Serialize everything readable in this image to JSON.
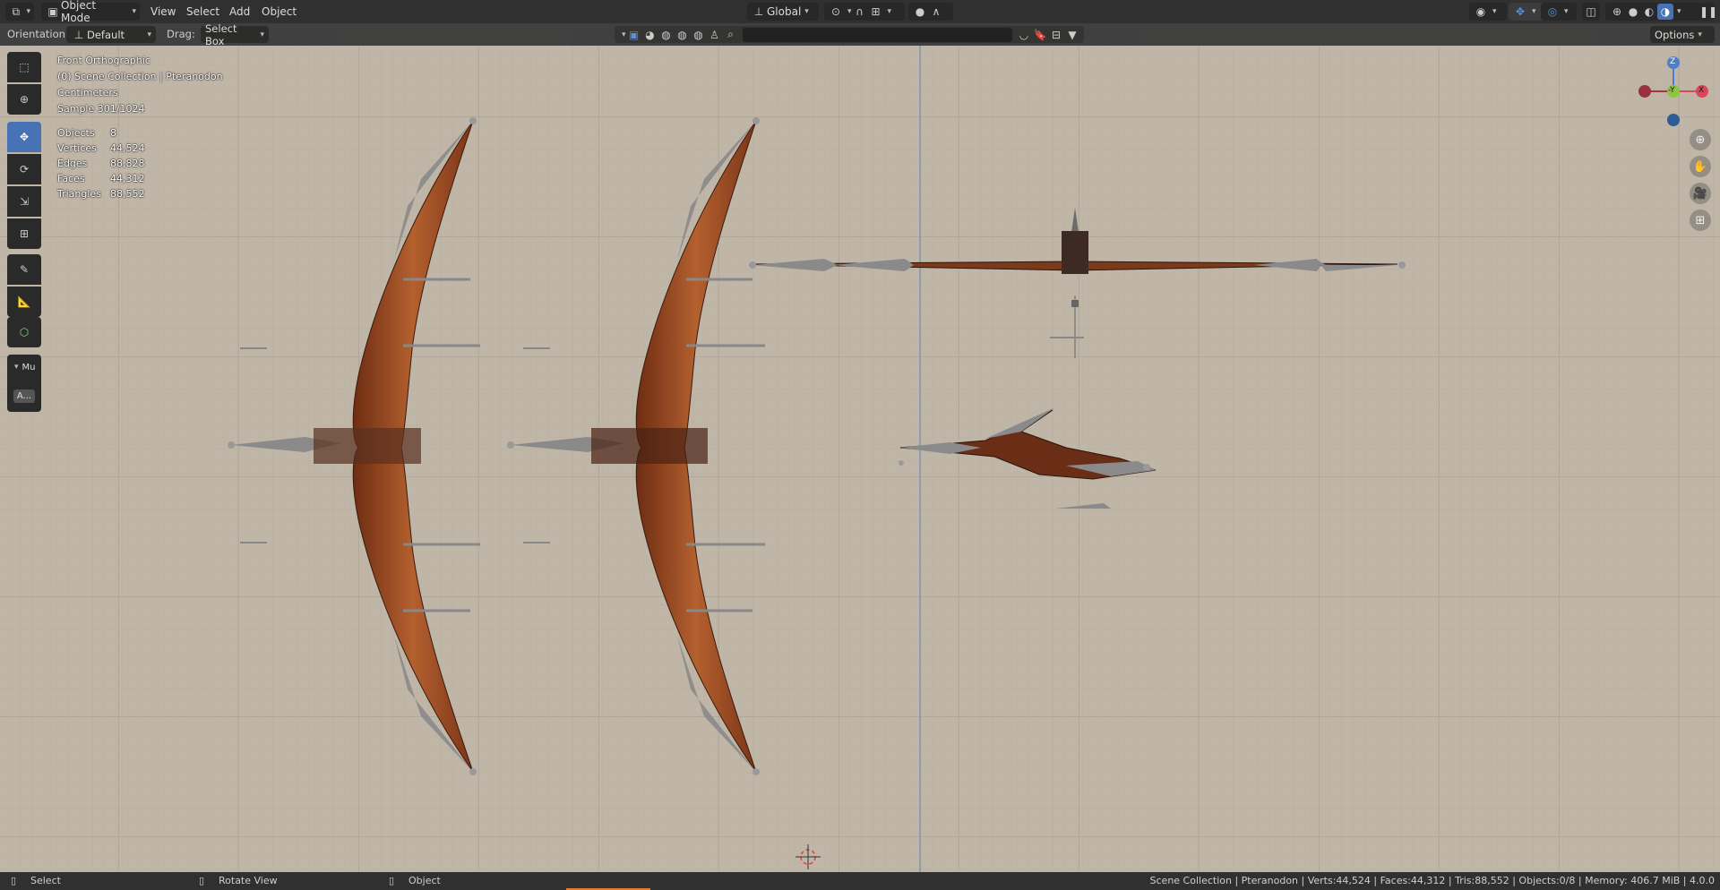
{
  "header": {
    "mode": "Object Mode",
    "menus": [
      "View",
      "Select",
      "Add",
      "Object"
    ],
    "orientation": "Global",
    "options_label": "Options"
  },
  "tool_settings": {
    "orientation_label": "Orientation:",
    "orientation_value": "Default",
    "drag_label": "Drag:",
    "drag_value": "Select Box"
  },
  "toolbar": {
    "collapsed_label": "Mu",
    "extra_label": "A..."
  },
  "viewport": {
    "view_name": "Front Orthographic",
    "collection": "(0) Scene Collection | Pteranodon",
    "units": "Centimeters",
    "sample": "Sample 301/1024",
    "stats": [
      {
        "label": "Objects",
        "value": "8"
      },
      {
        "label": "Vertices",
        "value": "44,524"
      },
      {
        "label": "Edges",
        "value": "88,828"
      },
      {
        "label": "Faces",
        "value": "44,312"
      },
      {
        "label": "Triangles",
        "value": "88,552"
      }
    ],
    "axes": {
      "z": "Z",
      "y": "-Y",
      "x": "X"
    }
  },
  "statusbar": {
    "left_select": "Select",
    "left_rotate": "Rotate View",
    "left_object": "Object",
    "right": "Scene Collection | Pteranodon | Verts:44,524 | Faces:44,312 | Tris:88,552 | Objects:0/8 | Memory: 406.7 MiB | 4.0.0"
  },
  "colors": {
    "viewport_bg": "#bfb6a7",
    "grid": "#a9a092",
    "accent": "#4772b3",
    "header": "#303030",
    "wing": "#9a4a24",
    "bone": "#8c8c8c"
  }
}
